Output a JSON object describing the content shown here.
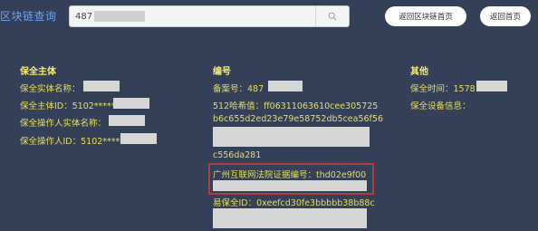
{
  "header": {
    "title": "区块链查询",
    "search_value": "487",
    "nav_buttons": [
      "返回区块链首页",
      "返回首页"
    ]
  },
  "left_column": {
    "heading": "保全主体",
    "rows": [
      "保全实体名称：",
      "保全主体ID：5102*****",
      "保全操作人实体名称：",
      "保全操作人ID：5102*****"
    ]
  },
  "middle_column": {
    "heading": "编号",
    "record_no": "备案号：487",
    "sha512_label": "512哈希值：ff06311063610cee305725",
    "sha512_line2": "b6c655d2ed23e79e58752db5cea56f56",
    "sha512_line3": "c556da281",
    "court_cert_label": "广州互联网法院证据编号：thd02e9f00",
    "yibaoquan_label": "易保全ID：0xeefcd30fe3bbbbb38b88c"
  },
  "right_column": {
    "heading": "其他",
    "time_label": "保全时间：1578",
    "device_label": "保全设备信息："
  },
  "colors": {
    "background": "#343f58",
    "heading": "#f4ed73",
    "text": "#e9df5c",
    "title": "#6aa6ee",
    "highlight_border": "#b13c3f"
  }
}
